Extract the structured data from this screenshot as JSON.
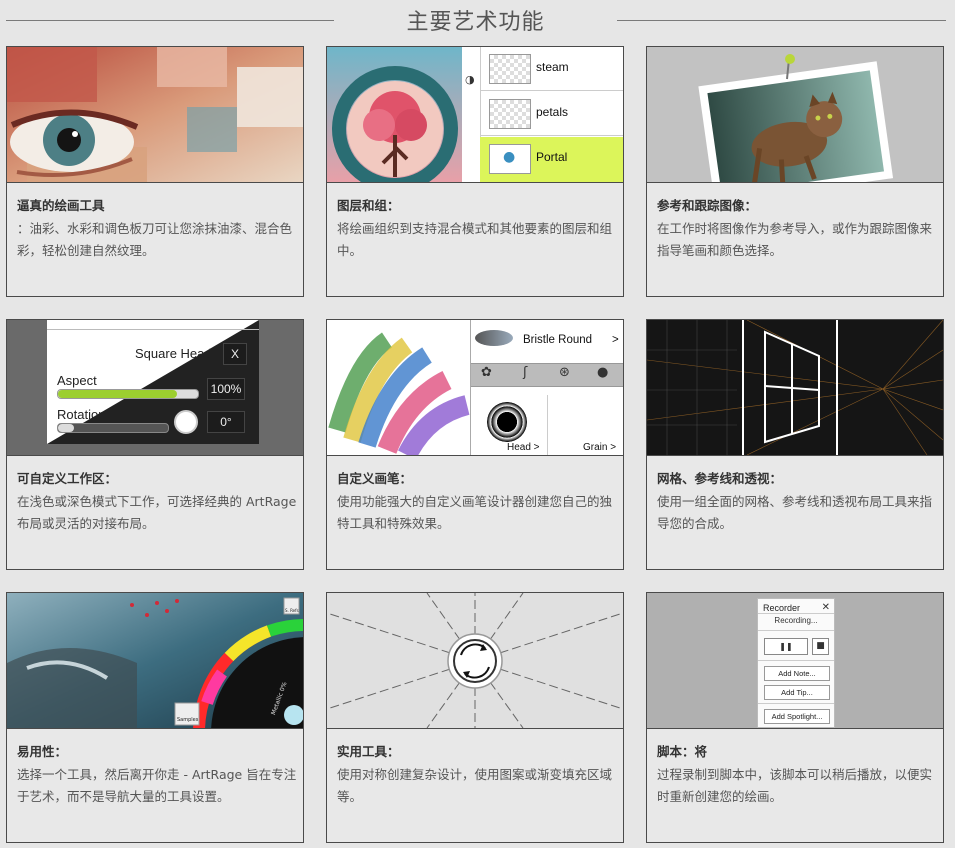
{
  "header": {
    "title": "主要艺术功能"
  },
  "cards": [
    {
      "title": "逼真的绘画工具",
      "desc": "：油彩、水彩和调色板刀可让您涂抹油漆、混合色彩，轻松创建自然纹理。"
    },
    {
      "title": "图层和组：",
      "desc": "将绘画组织到支持混合模式和其他要素的图层和组中。"
    },
    {
      "title": "参考和跟踪图像：",
      "desc": "在工作时将图像作为参考导入，或作为跟踪图像来指导笔画和颜色选择。"
    },
    {
      "title": "可自定义工作区：",
      "desc": "在浅色或深色模式下工作，可选择经典的 ArtRage 布局或灵活的对接布局。"
    },
    {
      "title": "自定义画笔：",
      "desc": "使用功能强大的自定义画笔设计器创建您自己的独特工具和特殊效果。"
    },
    {
      "title": "网格、参考线和透视：",
      "desc": "使用一组全面的网格、参考线和透视布局工具来指导您的合成。"
    },
    {
      "title": "易用性：",
      "desc": "选择一个工具，然后离开你走 - ArtRage 旨在专注于艺术，而不是导航大量的工具设置。"
    },
    {
      "title": "实用工具：",
      "desc": "使用对称创建复杂设计，使用图案或渐变填充区域等。"
    },
    {
      "title": "脚本：将",
      "desc": "过程录制到脚本中，该脚本可以稍后播放，以便实时重新创建您的绘画。"
    }
  ],
  "layers": {
    "items": [
      {
        "name": "steam"
      },
      {
        "name": "petals"
      },
      {
        "name": "Portal"
      }
    ],
    "selected_color": "#dcf55a"
  },
  "workspace": {
    "brush_name": "Square Head",
    "close_label": "X",
    "aspect_label": "Aspect",
    "aspect_value": "100%",
    "rotation_label": "Rotation",
    "rotation_value": "0°",
    "aspect_level": 0.85
  },
  "brush": {
    "name": "Bristle Round",
    "arrow": ">",
    "head_label": "Head >",
    "grain_label": "Grain >"
  },
  "color_wheel": {
    "samples_label": "Samples",
    "metallic_label": "Metallic 0%",
    "swatch_label": "S. Refs"
  },
  "recorder": {
    "title": "Recorder",
    "close": "✕",
    "status": "Recording...",
    "pause": "❚❚",
    "stop": "■",
    "add_note": "Add Note...",
    "add_tip": "Add Tip...",
    "add_spotlight": "Add Spotlight..."
  }
}
